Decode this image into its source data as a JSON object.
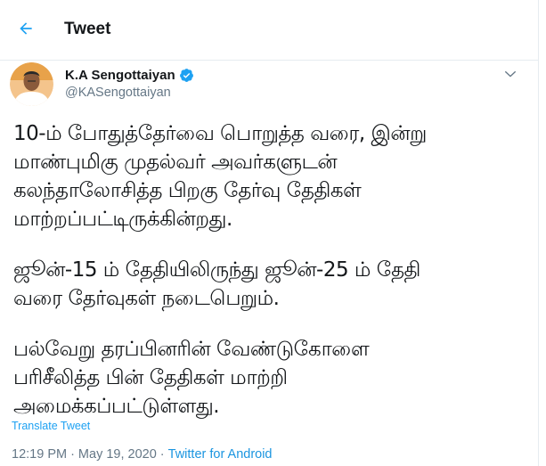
{
  "header": {
    "back_icon": "arrow-left-icon",
    "title": "Tweet"
  },
  "author": {
    "display_name": "K.A Sengottaiyan",
    "handle": "@KASengottaiyan",
    "verified_icon": "verified-badge-icon"
  },
  "more_icon": "chevron-down-icon",
  "tweet": {
    "paragraphs": [
      "10-ம் போதுத்தேர்வை பொறுத்த வரை, இன்று\nமாண்புமிகு முதல்வர் அவர்களுடன்\nகலந்தாலோசித்த பிறகு தேர்வு தேதிகள்\nமாற்றப்பட்டிருக்கின்றது.",
      "ஜூன்-15 ம் தேதியிலிருந்து ஜூன்-25 ம் தேதி\nவரை தேர்வுகள் நடைபெறும்.",
      "பல்வேறு தரப்பினரின் வேண்டுகோளை\nபரிசீலித்த பின் தேதிகள் மாற்றி\nஅமைக்கப்பட்டுள்ளது."
    ],
    "translate_label": "Translate Tweet",
    "time": "12:19 PM",
    "separator": "·",
    "date": "May 19, 2020",
    "source": "Twitter for Android"
  },
  "colors": {
    "accent": "#1da1f2",
    "secondary_text": "#657786"
  }
}
